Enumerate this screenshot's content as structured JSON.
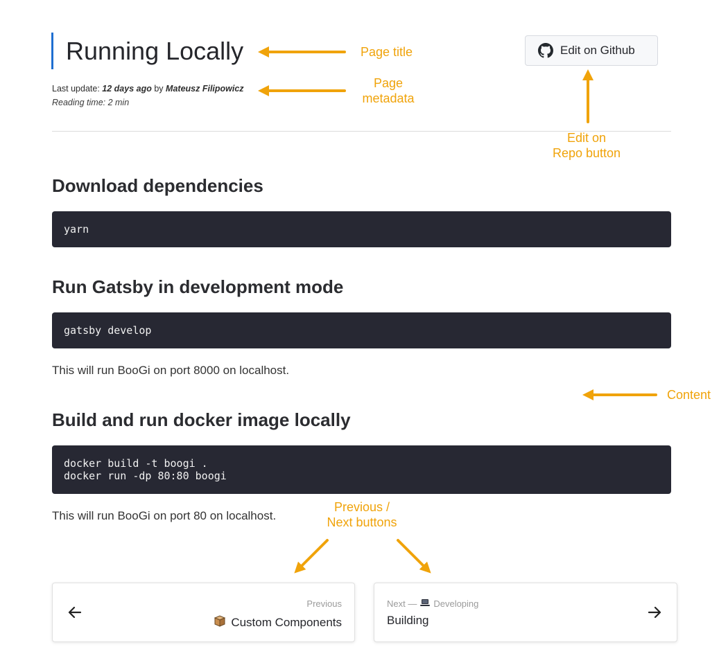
{
  "page": {
    "title": "Running Locally",
    "meta": {
      "last_update_label": "Last update:",
      "last_update_value": "12 days ago",
      "by_label": "by",
      "author": "Mateusz Filipowicz",
      "reading_time": "Reading time: 2 min"
    },
    "edit_button_label": "Edit on Github",
    "edit_button_icon": "github-icon"
  },
  "content": {
    "sections": [
      {
        "heading": "Download dependencies",
        "code": [
          "yarn"
        ]
      },
      {
        "heading": "Run Gatsby in development mode",
        "code": [
          "gatsby develop"
        ],
        "paragraph": "This will run BooGi on port 8000 on localhost."
      },
      {
        "heading": "Build and run docker image locally",
        "code": [
          "docker build -t boogi .",
          "docker run -dp 80:80 boogi"
        ],
        "paragraph": "This will run BooGi on port 80 on localhost."
      }
    ]
  },
  "navigation": {
    "previous": {
      "caption": "Previous",
      "title": "Custom Components",
      "icon": "box-icon"
    },
    "next": {
      "caption_prefix": "Next —",
      "caption_group": "Developing",
      "group_icon": "laptop-icon",
      "title": "Building"
    }
  },
  "annotations": {
    "page_title": "Page title",
    "page_metadata_line1": "Page",
    "page_metadata_line2": "metadata",
    "edit_button_line1": "Edit on",
    "edit_button_line2": "Repo button",
    "content": "Content",
    "prevnext_line1": "Previous /",
    "prevnext_line2": "Next buttons",
    "color": "#f0a30a"
  },
  "colors": {
    "accent_bar": "#1f6fd1",
    "code_background": "#272833",
    "annotation": "#f0a30a"
  }
}
